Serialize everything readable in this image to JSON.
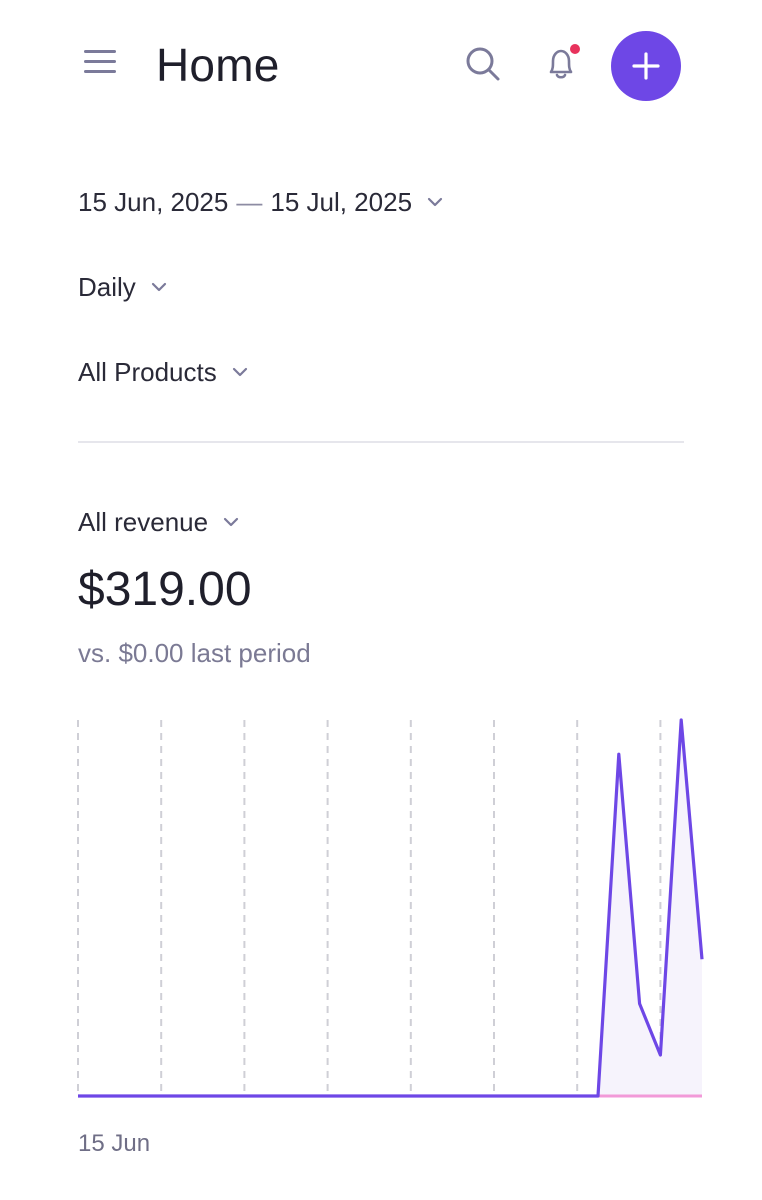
{
  "header": {
    "title": "Home",
    "icons": [
      "menu-icon",
      "search-icon",
      "bell-icon",
      "plus-icon"
    ],
    "notification_dot_color": "#e8325c",
    "accent_color": "#6e47e6"
  },
  "filters": {
    "date_start": "15 Jun, 2025",
    "date_separator": "—",
    "date_end": "15 Jul, 2025",
    "interval": "Daily",
    "products": "All Products"
  },
  "metric": {
    "label": "All revenue",
    "value": "$319.00",
    "comparison": "vs. $0.00 last period"
  },
  "chart_data": {
    "type": "line",
    "title": "",
    "x_start_label": "15 Jun",
    "series": [
      {
        "name": "",
        "color": "#6e47e6",
        "values": [
          0,
          0,
          0,
          0,
          0,
          0,
          0,
          0,
          0,
          0,
          0,
          0,
          0,
          0,
          0,
          0,
          0,
          0,
          0,
          0,
          0,
          0,
          0,
          0,
          0,
          0,
          100,
          27,
          12,
          110,
          40
        ]
      },
      {
        "name": "",
        "color": "#f29ad8",
        "values": [
          0,
          0,
          0,
          0,
          0,
          0,
          0,
          0,
          0,
          0,
          0,
          0,
          0,
          0,
          0,
          0,
          0,
          0,
          0,
          0,
          0,
          0,
          0,
          0,
          0,
          0,
          0,
          0,
          0,
          0,
          0
        ]
      }
    ],
    "ylim": [
      0,
      110
    ],
    "grid": "vertical-dashed"
  }
}
